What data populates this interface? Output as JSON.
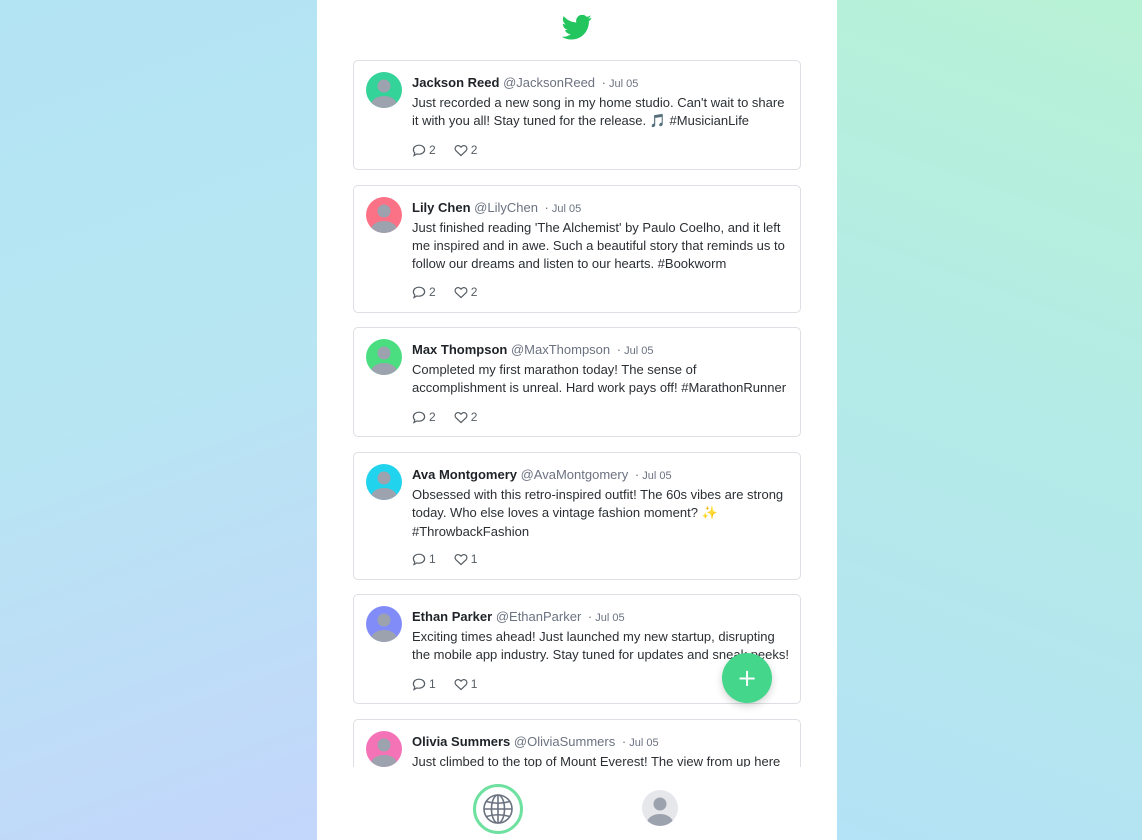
{
  "app": {
    "logo_icon": "twitter-bird-icon",
    "brand_color": "#22c55e"
  },
  "tweets": [
    {
      "name": "Jackson Reed",
      "handle": "@JacksonReed",
      "separator": "·",
      "date": "Jul 05",
      "text_before": "Just recorded a new song in my home studio. Can't wait to share it with you all! Stay tuned for the release. ",
      "emoji": "🎵",
      "text_after": " #MusicianLife",
      "comments": "2",
      "likes": "2",
      "avatar_color": "#34d399"
    },
    {
      "name": "Lily Chen",
      "handle": "@LilyChen",
      "separator": "·",
      "date": "Jul 05",
      "text_before": "Just finished reading 'The Alchemist' by Paulo Coelho, and it left me inspired and in awe. Such a beautiful story that reminds us to follow our dreams and listen to our hearts. #Bookworm",
      "emoji": "",
      "text_after": "",
      "comments": "2",
      "likes": "2",
      "avatar_color": "#fb7185"
    },
    {
      "name": "Max Thompson",
      "handle": "@MaxThompson",
      "separator": "·",
      "date": "Jul 05",
      "text_before": "Completed my first marathon today! The sense of accomplishment is unreal. Hard work pays off! #MarathonRunner",
      "emoji": "",
      "text_after": "",
      "comments": "2",
      "likes": "2",
      "avatar_color": "#4ade80"
    },
    {
      "name": "Ava Montgomery",
      "handle": "@AvaMontgomery",
      "separator": "·",
      "date": "Jul 05",
      "text_before": "Obsessed with this retro-inspired outfit! The 60s vibes are strong today. Who else loves a vintage fashion moment? ",
      "emoji": "✨",
      "text_after": " #ThrowbackFashion",
      "comments": "1",
      "likes": "1",
      "avatar_color": "#22d3ee"
    },
    {
      "name": "Ethan Parker",
      "handle": "@EthanParker",
      "separator": "·",
      "date": "Jul 05",
      "text_before": "Exciting times ahead! Just launched my new startup, disrupting the mobile app industry. Stay tuned for updates and sneak peeks!",
      "emoji": "",
      "text_after": "",
      "comments": "1",
      "likes": "1",
      "avatar_color": "#818cf8"
    },
    {
      "name": "Olivia Summers",
      "handle": "@OliviaSummers",
      "separator": "·",
      "date": "Jul 05",
      "text_before": "Just climbed to the top of Mount Everest! The view from up here is",
      "emoji": "",
      "text_after": "",
      "comments": "",
      "likes": "",
      "avatar_color": "#f472b6"
    }
  ],
  "fab": {
    "label": "+",
    "icon": "plus-icon",
    "color": "#44d68a"
  },
  "bottom_nav": {
    "home_icon": "globe-icon",
    "profile_icon": "user-avatar-icon",
    "active_ring_color": "#6ee0a0"
  }
}
